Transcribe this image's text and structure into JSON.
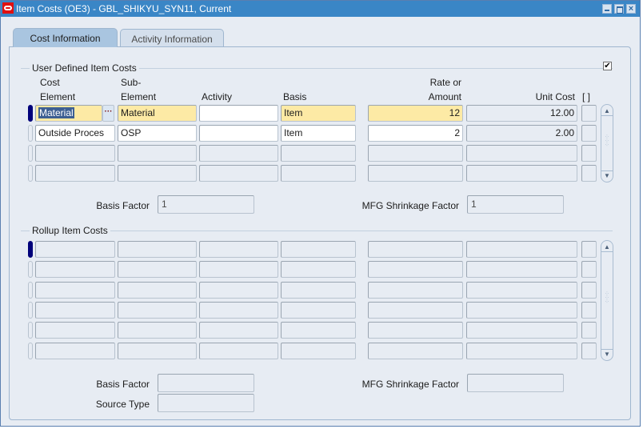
{
  "window": {
    "title": "Item Costs (OE3) - GBL_SHIKYU_SYN11, Current",
    "app_icon": "oracle-icon",
    "controls": {
      "minimize": "minimize-icon",
      "maximize": "maximize-icon",
      "close": "×"
    }
  },
  "tabs": [
    {
      "label": "Cost Information",
      "active": true
    },
    {
      "label": "Activity Information",
      "active": false
    }
  ],
  "user_defined": {
    "legend": "User Defined Item Costs",
    "checkbox_checked": true,
    "checkbox_mark": "✔",
    "headers": {
      "cost_element_1": "Cost",
      "cost_element_2": "Element",
      "sub_element_1": "Sub-",
      "sub_element_2": "Element",
      "activity": "Activity",
      "basis": "Basis",
      "rate_1": "Rate or",
      "rate_2": "Amount",
      "unit_cost": "Unit Cost",
      "flex": "[ ]"
    },
    "lov_label": "···",
    "rows": [
      {
        "cost_element": "Material",
        "sub_element": "Material",
        "activity": "",
        "basis": "Item",
        "rate": "12",
        "unit_cost": "12.00",
        "current": true
      },
      {
        "cost_element": "Outside Proces",
        "sub_element": "OSP",
        "activity": "",
        "basis": "Item",
        "rate": "2",
        "unit_cost": "2.00",
        "current": false
      },
      {
        "cost_element": "",
        "sub_element": "",
        "activity": "",
        "basis": "",
        "rate": "",
        "unit_cost": "",
        "current": false
      },
      {
        "cost_element": "",
        "sub_element": "",
        "activity": "",
        "basis": "",
        "rate": "",
        "unit_cost": "",
        "current": false
      }
    ],
    "basis_factor_label": "Basis Factor",
    "basis_factor_value": "1",
    "mfg_shrinkage_label": "MFG Shrinkage Factor",
    "mfg_shrinkage_value": "1"
  },
  "rollup": {
    "legend": "Rollup Item Costs",
    "row_count": 6,
    "basis_factor_label": "Basis Factor",
    "basis_factor_value": "",
    "mfg_shrinkage_label": "MFG Shrinkage Factor",
    "mfg_shrinkage_value": "",
    "source_type_label": "Source Type",
    "source_type_value": ""
  },
  "scrollbar": {
    "up": "▲",
    "down": "▼",
    "grip": "⋰⋰⋰"
  }
}
